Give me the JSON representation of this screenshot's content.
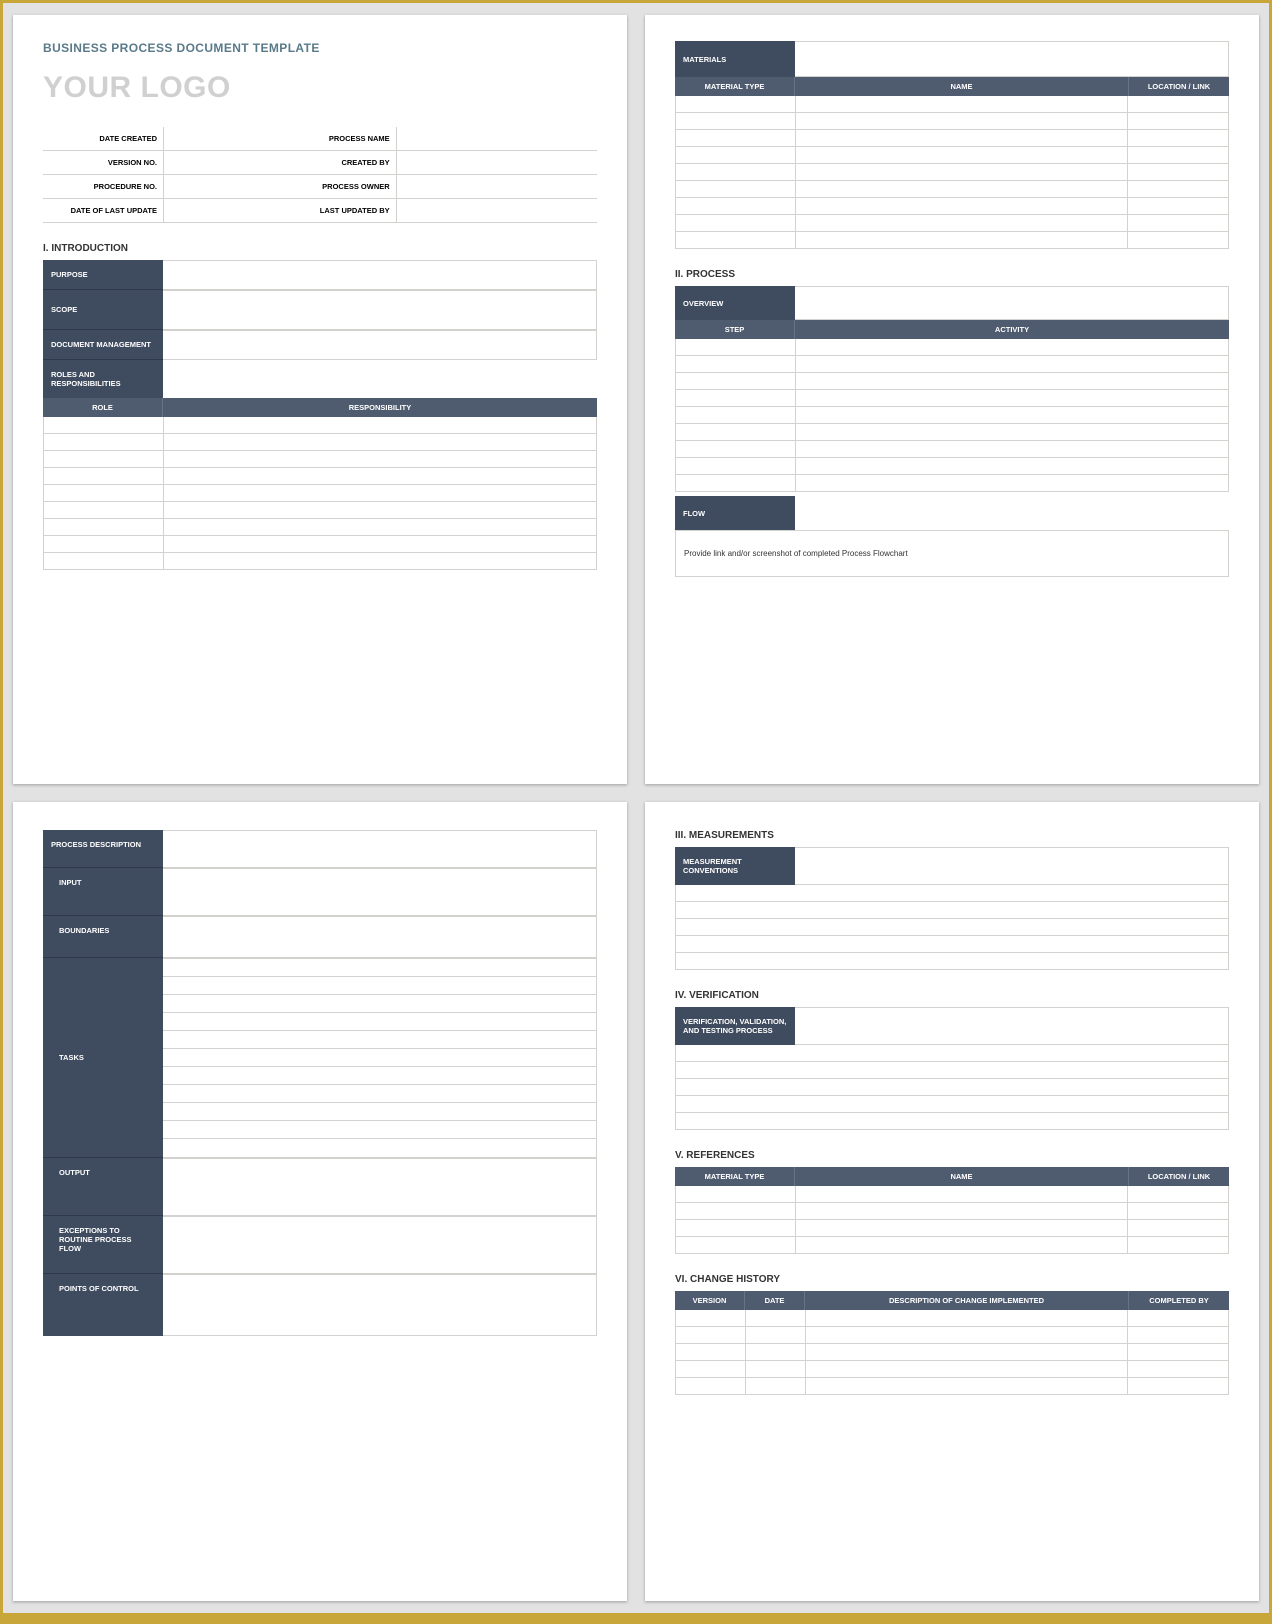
{
  "title": "BUSINESS PROCESS DOCUMENT TEMPLATE",
  "logo": "YOUR LOGO",
  "meta": {
    "date_created": {
      "label": "DATE CREATED"
    },
    "process_name": {
      "label": "PROCESS NAME"
    },
    "version_no": {
      "label": "VERSION NO."
    },
    "created_by": {
      "label": "CREATED BY"
    },
    "procedure_no": {
      "label": "PROCEDURE NO."
    },
    "process_owner": {
      "label": "PROCESS OWNER"
    },
    "date_last_update": {
      "label": "DATE OF LAST UPDATE"
    },
    "last_updated_by": {
      "label": "LAST UPDATED BY"
    }
  },
  "sections": {
    "intro": {
      "title": "I.   INTRODUCTION",
      "purpose": "PURPOSE",
      "scope": "SCOPE",
      "doc_mgmt": "DOCUMENT MANAGEMENT",
      "roles": "ROLES AND RESPONSIBILITIES",
      "role_hdr": [
        "ROLE",
        "RESPONSIBILITY"
      ]
    },
    "materials": {
      "title": "MATERIALS",
      "hdr": [
        "MATERIAL TYPE",
        "NAME",
        "LOCATION / LINK"
      ]
    },
    "process": {
      "title": "II.  PROCESS",
      "overview": "OVERVIEW",
      "hdr": [
        "STEP",
        "ACTIVITY"
      ],
      "flow": "FLOW",
      "flow_note": "Provide link and/or screenshot of completed Process Flowchart"
    },
    "p3": {
      "proc_desc": "PROCESS DESCRIPTION",
      "input": "INPUT",
      "boundaries": "BOUNDARIES",
      "tasks": "TASKS",
      "output": "OUTPUT",
      "exceptions": "EXCEPTIONS TO ROUTINE PROCESS FLOW",
      "points": "POINTS OF CONTROL"
    },
    "measurements": {
      "title": "III. MEASUREMENTS",
      "conv": "MEASUREMENT CONVENTIONS"
    },
    "verification": {
      "title": "IV. VERIFICATION",
      "lbl": "VERIFICATION, VALIDATION, AND TESTING PROCESS"
    },
    "references": {
      "title": "V.  REFERENCES",
      "hdr": [
        "MATERIAL TYPE",
        "NAME",
        "LOCATION / LINK"
      ]
    },
    "history": {
      "title": "VI. CHANGE HISTORY",
      "hdr": [
        "VERSION",
        "DATE",
        "DESCRIPTION OF CHANGE IMPLEMENTED",
        "COMPLETED BY"
      ]
    }
  }
}
